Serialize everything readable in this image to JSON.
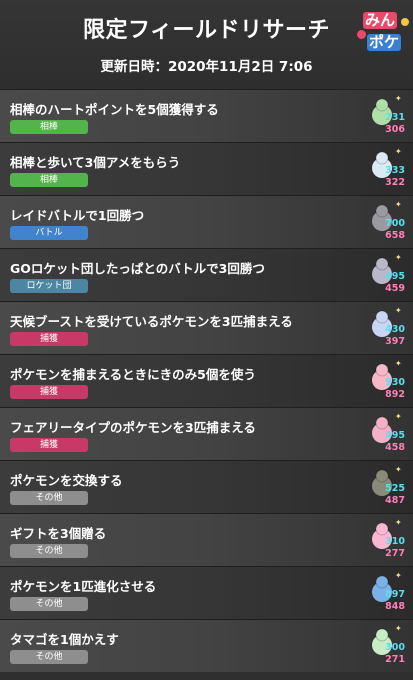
{
  "header": {
    "title": "限定フィールドリサーチ",
    "updated": "更新日時：2020年11月2日 7:06",
    "logo_line1": "みん",
    "logo_line2": "ポケ"
  },
  "category_colors": {
    "相棒": "#52b44a",
    "バトル": "#3f84cc",
    "ロケット団": "#4d86a3",
    "捕獲": "#c73a67",
    "その他": "#8e8e8e"
  },
  "tasks": [
    {
      "text": "相棒のハートポイントを5個獲得する",
      "category": "相棒",
      "cp_min": "231",
      "cp_max": "306",
      "icon": "gardevoir-icon",
      "color": "#b0e0a8"
    },
    {
      "text": "相棒と歩いて3個アメをもらう",
      "category": "相棒",
      "cp_min": "333",
      "cp_max": "322",
      "icon": "seel-icon",
      "color": "#dce8f2"
    },
    {
      "text": "レイドバトルで1回勝つ",
      "category": "バトル",
      "cp_min": "700",
      "cp_max": "658",
      "icon": "onix-icon",
      "color": "#9a9aa0"
    },
    {
      "text": "GOロケット団したっぱとのバトルで3回勝つ",
      "category": "ロケット団",
      "cp_min": "495",
      "cp_max": "459",
      "icon": "shadow-pokemon-icon",
      "color": "#b8b8c8"
    },
    {
      "text": "天候ブーストを受けているポケモンを3匹捕まえる",
      "category": "捕獲",
      "cp_min": "430",
      "cp_max": "397",
      "icon": "dratini-icon",
      "color": "#c8d6f4"
    },
    {
      "text": "ポケモンを捕まえるときにきのみ5個を使う",
      "category": "捕獲",
      "cp_min": "930",
      "cp_max": "892",
      "icon": "clefable-icon",
      "color": "#f6b8c8"
    },
    {
      "text": "フェアリータイプのポケモンを3匹捕まえる",
      "category": "捕獲",
      "cp_min": "495",
      "cp_max": "458",
      "icon": "clefairy-icon",
      "color": "#f4b0c6"
    },
    {
      "text": "ポケモンを交換する",
      "category": "その他",
      "cp_min": "525",
      "cp_max": "487",
      "icon": "pinsir-icon",
      "color": "#8a8a7a"
    },
    {
      "text": "ギフトを3個贈る",
      "category": "その他",
      "cp_min": "310",
      "cp_max": "277",
      "icon": "jigglypuff-icon",
      "color": "#f9b7d1"
    },
    {
      "text": "ポケモンを1匹進化させる",
      "category": "その他",
      "cp_min": "897",
      "cp_max": "848",
      "icon": "dragonair-icon",
      "color": "#7cb0e8"
    },
    {
      "text": "タマゴを1個かえす",
      "category": "その他",
      "cp_min": "300",
      "cp_max": "271",
      "icon": "togetic-icon",
      "color": "#c8ecc4"
    }
  ]
}
